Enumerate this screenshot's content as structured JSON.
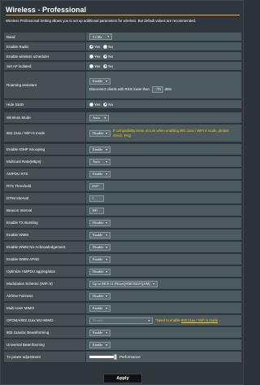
{
  "header": {
    "title": "Wireless - Professional",
    "description": "Wireless Professional Setting allows you to set up additional parameters for wireless. But default values are recommended."
  },
  "rows": {
    "band": {
      "label": "Band",
      "value": "5 GHz"
    },
    "enable_radio": {
      "label": "Enable Radio",
      "yes": "Yes",
      "no": "No",
      "selected": "Yes"
    },
    "wireless_scheduler": {
      "label": "Enable wireless scheduler",
      "yes": "Yes",
      "no": "No",
      "selected": "No"
    },
    "ap_isolated": {
      "label": "Set AP isolated",
      "yes": "Yes",
      "no": "No",
      "selected": "No"
    },
    "roaming": {
      "label": "Roaming assistant",
      "value": "Enable",
      "rssi_text": "Disconnect clients with RSSI lower than",
      "rssi_value": "-70",
      "unit": "dBm"
    },
    "hide_ssid": {
      "label": "Hide SSID",
      "yes": "Yes",
      "no": "No",
      "selected": "No"
    },
    "wireless_mode": {
      "label": "Wireless Mode",
      "value": "Auto"
    },
    "wifi6": {
      "label": "802.11ax / WiFi 6 mode",
      "value": "Disable",
      "warning": "If compatibility issue occurs when enabling 802.11ax / WiFi 6 mode, please check: FAQ"
    },
    "igmp": {
      "label": "Enable IGMP Snooping",
      "value": "Enable"
    },
    "multicast": {
      "label": "Multicast Rate(Mbps)",
      "value": "Auto"
    },
    "ampdu_rts": {
      "label": "AMPDU RTS",
      "value": "Enable"
    },
    "rts_threshold": {
      "label": "RTS Threshold",
      "value": "2347"
    },
    "dtim": {
      "label": "DTIM Interval",
      "value": "1"
    },
    "beacon": {
      "label": "Beacon Interval",
      "value": "100"
    },
    "tx_bursting": {
      "label": "Enable TX Bursting",
      "value": "Disable"
    },
    "wmm": {
      "label": "Enable WMM",
      "value": "Enable"
    },
    "wmm_noack": {
      "label": "Enable WMM No-Acknowledgement",
      "value": "Disable"
    },
    "wmm_apsd": {
      "label": "Enable WMM APSD",
      "value": "Enable"
    },
    "ampdu_agg": {
      "label": "Optimize AMPDU aggregation",
      "value": "Disable"
    },
    "modulation": {
      "label": "Modulation Scheme (WiFi 5)",
      "value": "Up to MCS 11 (NitroQAM/1024-QAM)"
    },
    "airtime": {
      "label": "Airtime Fairness",
      "value": "Disable"
    },
    "mu_mimo": {
      "label": "Multi-User MIMO",
      "value": "Enable"
    },
    "ofdma": {
      "label": "OFDMA/802.11ax MU-MIMO",
      "value": "Disable",
      "note_prefix": "*Need to enable ",
      "note_link": "802.11ax / WiFi 6 mode"
    },
    "bf_ax": {
      "label": "802.11ax/ac Beamforming",
      "value": "Enable"
    },
    "bf_universal": {
      "label": "Universal Beamforming",
      "value": "Enable"
    },
    "tx_power": {
      "label": "Tx power adjustment",
      "value_text": "Performance",
      "level": 1.0
    }
  },
  "actions": {
    "apply_label": "Apply"
  },
  "colors": {
    "accent": "#ffa51f",
    "warning": "#ffcc00",
    "radio_on": "#1a6fd6"
  }
}
